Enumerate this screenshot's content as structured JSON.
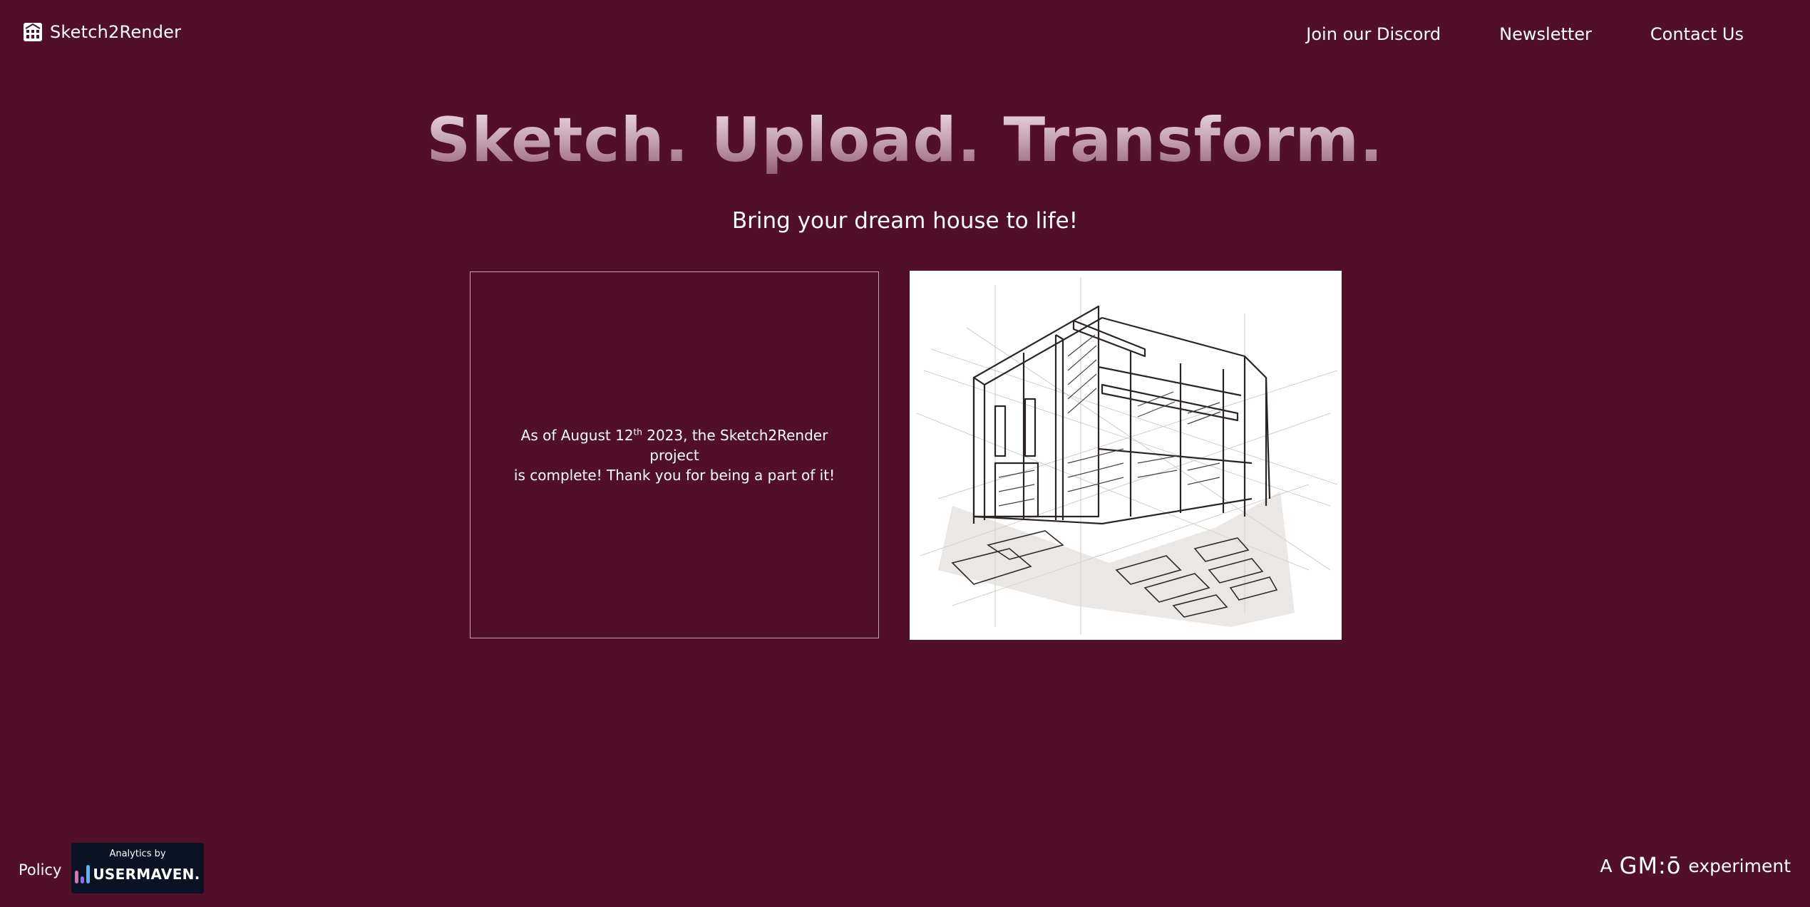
{
  "header": {
    "brand_name": "Sketch2Render",
    "brand_icon": "house-grid-icon",
    "nav": [
      "Join our Discord",
      "Newsletter",
      "Contact Us"
    ]
  },
  "hero": {
    "title": "Sketch. Upload. Transform.",
    "subtitle": "Bring your dream house to life!"
  },
  "notice": {
    "line1_prefix": "As of August 12",
    "line1_superscript": "th",
    "line1_suffix": " 2023, the Sketch2Render project",
    "line2": "is complete! Thank you for being a part of it!"
  },
  "sketch": {
    "icon": "house-sketch-illustration"
  },
  "footer": {
    "policy": "Policy",
    "analytics_by": "Analytics by",
    "analytics_brand": "USERMAVEN.",
    "credit_prefix": "A",
    "credit_logo": "GM:ō",
    "credit_suffix": "experiment"
  },
  "colors": {
    "background": "#520f2a",
    "text": "#ffffff",
    "notice_border": "#c8a2b2",
    "analytics_bg": "#0b1226",
    "usermaven_bar_pink": "#e06fb6",
    "usermaven_bar_purple": "#8a6cf0",
    "usermaven_bar_blue": "#56b7f0"
  }
}
